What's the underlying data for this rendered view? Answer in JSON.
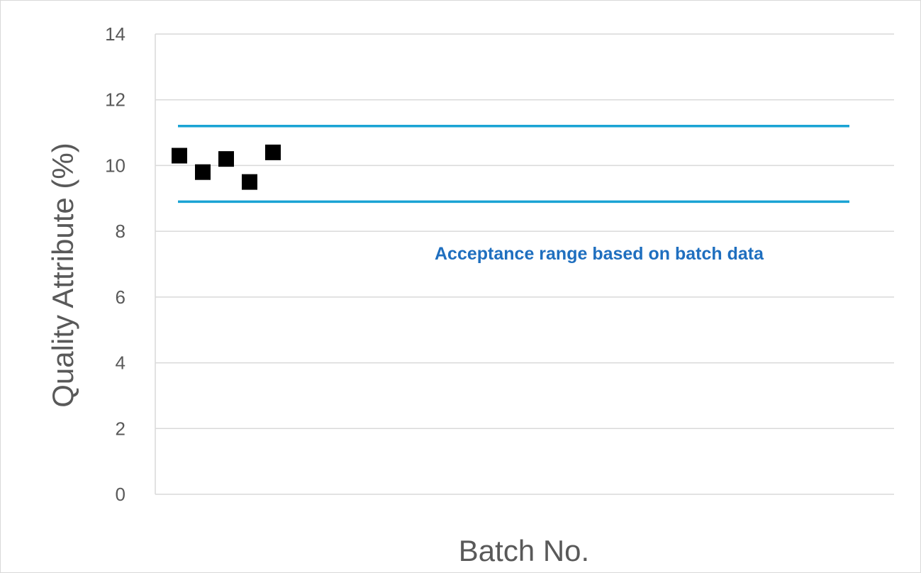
{
  "chart_data": {
    "type": "scatter",
    "title": "",
    "xlabel": "Batch No.",
    "ylabel": "Quality Attribute (%)",
    "ylim": [
      0,
      14
    ],
    "y_ticks": [
      "0",
      "2",
      "4",
      "6",
      "8",
      "10",
      "12",
      "14"
    ],
    "grid": true,
    "series": [
      {
        "x": [
          1,
          2,
          3,
          4,
          5
        ],
        "y": [
          10.3,
          9.8,
          10.2,
          9.5,
          10.4
        ],
        "marker": "square",
        "color": "#000000"
      }
    ],
    "reference_lines": [
      {
        "y": 11.2,
        "color": "#1aa3d4"
      },
      {
        "y": 8.9,
        "color": "#1aa3d4"
      }
    ],
    "annotation": {
      "text": "Acceptance range based on batch data",
      "color": "#1f6fbf"
    }
  }
}
